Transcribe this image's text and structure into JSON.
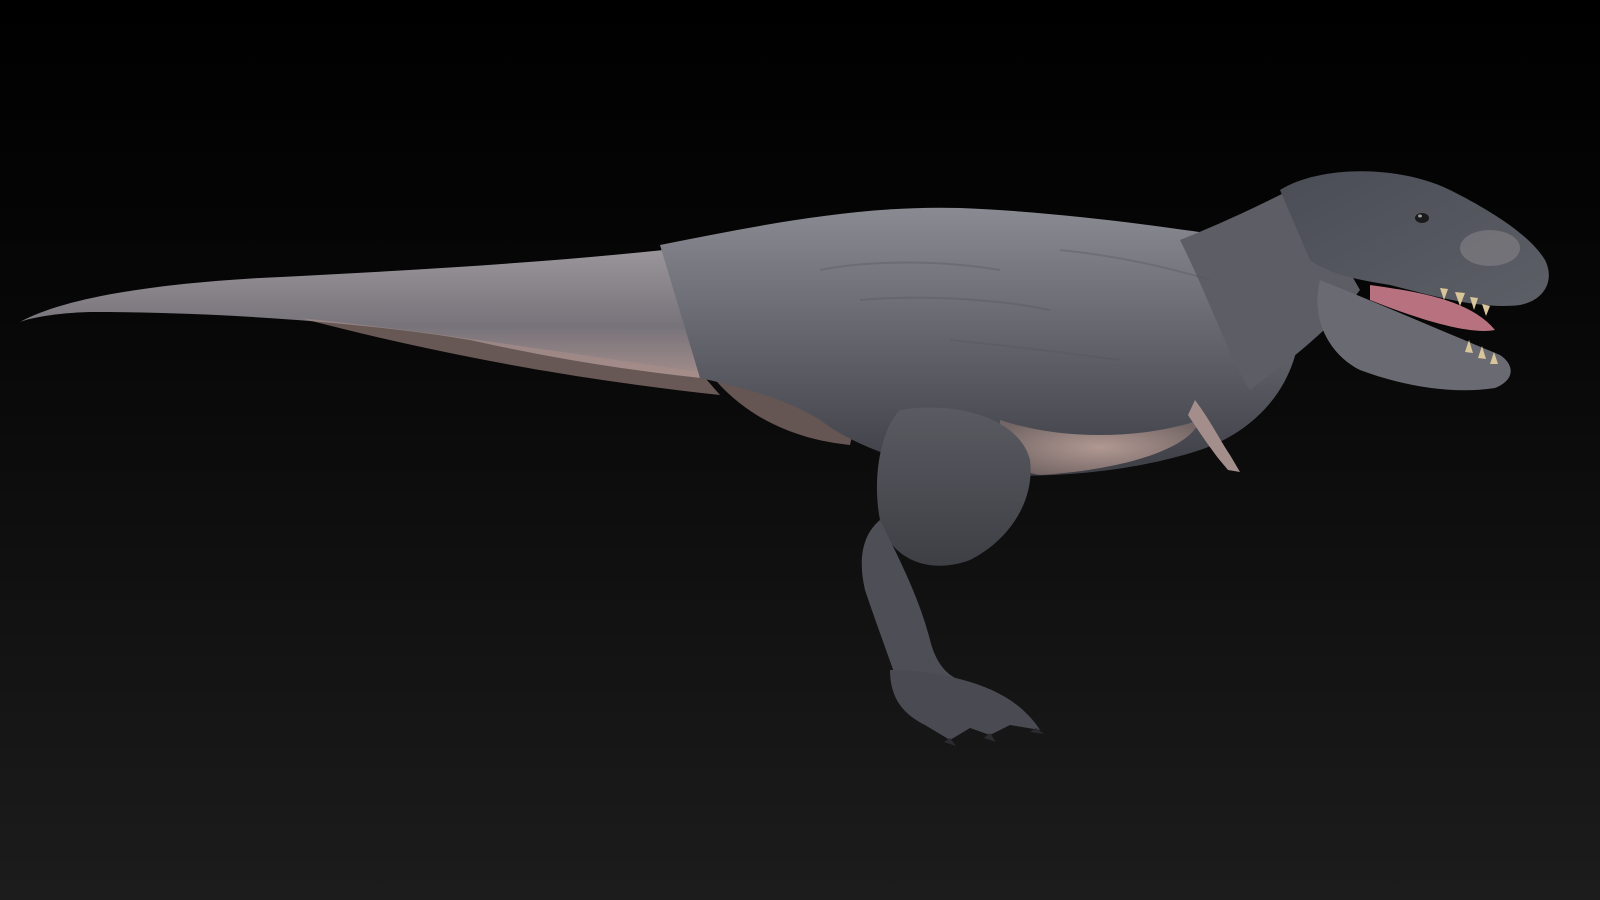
{
  "scene": {
    "subject": "dinosaur-model",
    "colors": {
      "background_top": "#000000",
      "background_bottom": "#1c1c1c",
      "skin_dark": "#3f4148",
      "skin_mid": "#6a6b72",
      "skin_light": "#9a9498",
      "underbelly": "#b89c94",
      "mouth": "#c07a88",
      "teeth": "#d9c59a"
    }
  }
}
